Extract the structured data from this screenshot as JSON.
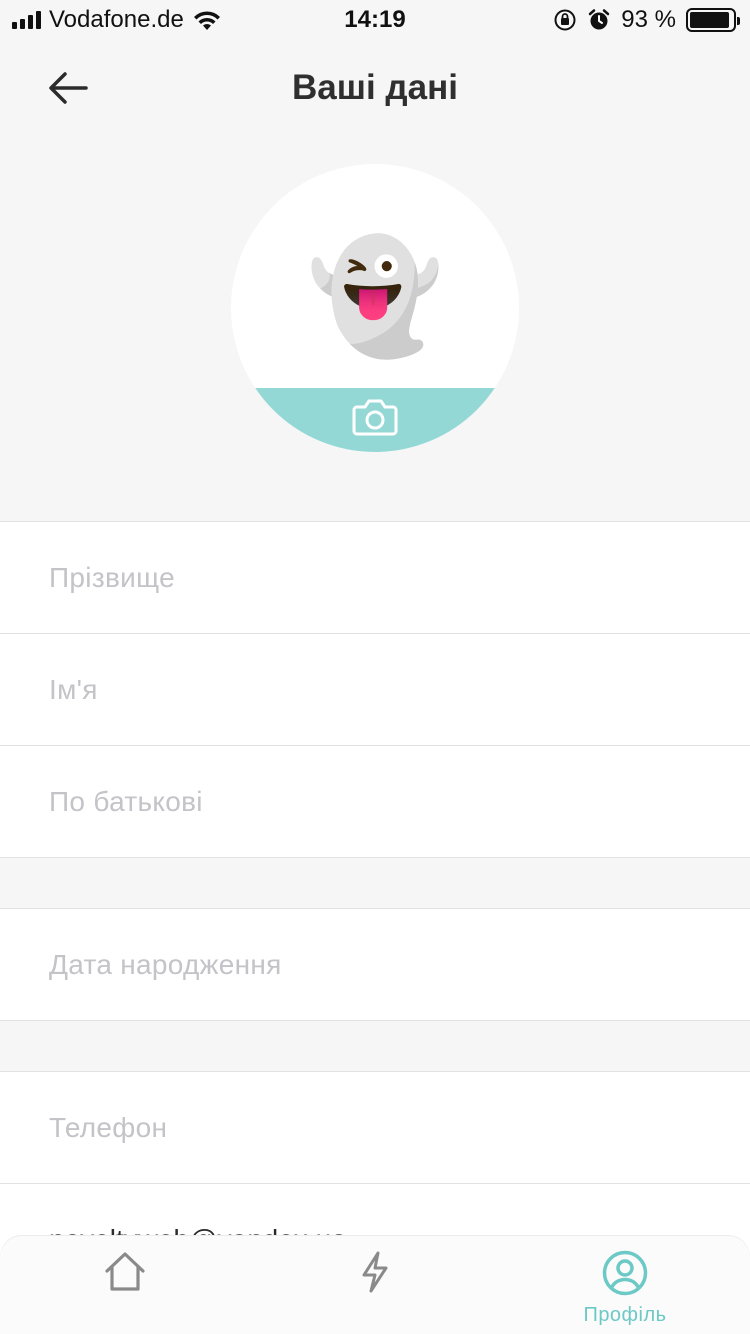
{
  "status_bar": {
    "carrier": "Vodafone.de",
    "time": "14:19",
    "battery": "93 %",
    "battery_level": 0.93,
    "icons": [
      "signal-icon",
      "wifi-icon",
      "orientation-lock-icon",
      "alarm-icon",
      "battery-icon"
    ]
  },
  "header": {
    "title": "Ваші дані",
    "back_icon": "arrow-left-icon"
  },
  "avatar": {
    "emoji": "👻",
    "camera_icon": "camera-icon",
    "band_color": "#94d8d6"
  },
  "form": {
    "last_name_placeholder": "Прізвище",
    "first_name_placeholder": "Ім'я",
    "patronymic_placeholder": "По батькові",
    "birthdate_placeholder": "Дата народження",
    "phone_placeholder": "Телефон",
    "email_value": "noveltyweb@yandex.ua"
  },
  "tab_bar": {
    "home_icon": "home-icon",
    "activity_icon": "lightning-icon",
    "profile_icon": "user-circle-icon",
    "profile_label": "Профіль",
    "accent_color": "#6cc9c6"
  }
}
